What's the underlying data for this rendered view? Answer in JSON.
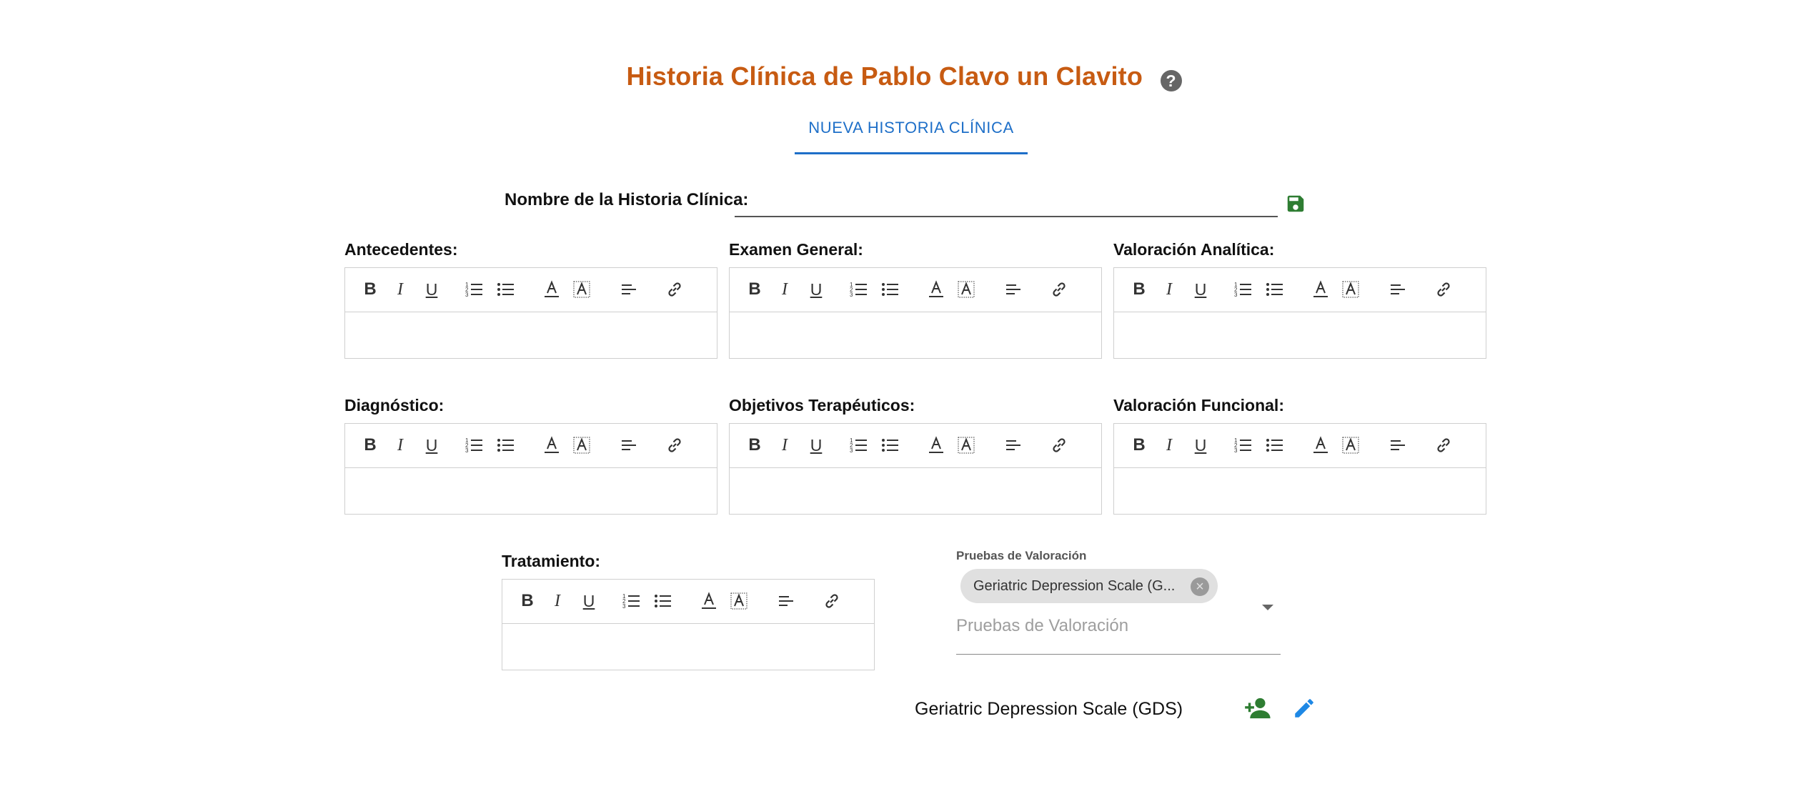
{
  "header": {
    "title": "Historia Clínica de Pablo Clavo un Clavito",
    "help_icon": "question-circle-icon"
  },
  "tabs": [
    {
      "label": "NUEVA HISTORIA CLÍNICA",
      "active": true
    }
  ],
  "form": {
    "name_label": "Nombre de la Historia Clínica:",
    "name_value": "",
    "save_icon": "floppy-disk-icon",
    "save_color": "#2e7d32"
  },
  "editors": [
    {
      "label": "Antecedentes:"
    },
    {
      "label": "Examen General:"
    },
    {
      "label": "Valoración Analítica:"
    },
    {
      "label": "Diagnóstico:"
    },
    {
      "label": "Objetivos Terapéuticos:"
    },
    {
      "label": "Valoración Funcional:"
    },
    {
      "label": "Tratamiento:"
    }
  ],
  "toolbar": {
    "bold": "B",
    "italic": "I",
    "underline": "U",
    "icons": [
      "ordered-list-icon",
      "bullet-list-icon",
      "font-color-icon",
      "highlight-icon",
      "align-left-icon",
      "link-icon"
    ]
  },
  "assessments": {
    "label": "Pruebas de Valoración",
    "placeholder": "Pruebas de Valoración",
    "selected_chips": [
      "Geriatric Depression Scale (G..."
    ],
    "tests": [
      {
        "name": "Geriatric Depression Scale (GDS)"
      }
    ],
    "add_icon_color": "#2e7d32",
    "edit_icon_color": "#1e88e5"
  },
  "colors": {
    "title": "#c75b12",
    "accent": "#1e6fc8"
  }
}
